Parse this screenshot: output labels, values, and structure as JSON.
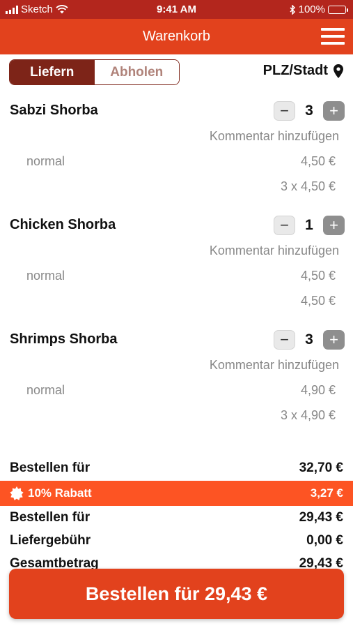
{
  "status_bar": {
    "carrier": "Sketch",
    "time": "9:41 AM",
    "battery": "100%",
    "icons": [
      "signal-icon",
      "wifi-icon",
      "bluetooth-icon",
      "battery-icon"
    ]
  },
  "header": {
    "title": "Warenkorb",
    "menu_icon": "hamburger-menu-icon"
  },
  "delivery_toggle": {
    "options": [
      "Liefern",
      "Abholen"
    ],
    "selected": "Liefern"
  },
  "location": {
    "label": "PLZ/Stadt",
    "icon": "location-pin-icon"
  },
  "items": [
    {
      "name": "Sabzi Shorba",
      "quantity": "3",
      "comment": "Kommentar hinzufügen",
      "variant": "normal",
      "unit_price": "4,50 €",
      "line_total": "3 x 4,50 €"
    },
    {
      "name": "Chicken Shorba",
      "quantity": "1",
      "comment": "Kommentar hinzufügen",
      "variant": "normal",
      "unit_price": "4,50 €",
      "line_total": "4,50 €"
    },
    {
      "name": "Shrimps Shorba",
      "quantity": "3",
      "comment": "Kommentar hinzufügen",
      "variant": "normal",
      "unit_price": "4,90 €",
      "line_total": "3 x 4,90 €"
    }
  ],
  "summary": {
    "subtotal_label": "Bestellen für",
    "subtotal_value": "32,70 €",
    "discount_label": "10% Rabatt",
    "discount_value": "3,27 €",
    "discount_icon": "discount-badge-icon",
    "after_discount_label": "Bestellen für",
    "after_discount_value": "29,43 €",
    "delivery_fee_label": "Liefergebühr",
    "delivery_fee_value": "0,00 €",
    "total_label": "Gesamtbetrag",
    "total_value": "29,43 €"
  },
  "order_button": {
    "label": "Bestellen für 29,43 €"
  },
  "colors": {
    "status_bar": "#b3261d",
    "header": "#e2421d",
    "toggle_active": "#7d2418",
    "discount_bar": "#fd5423",
    "order_button": "#e2421d"
  }
}
